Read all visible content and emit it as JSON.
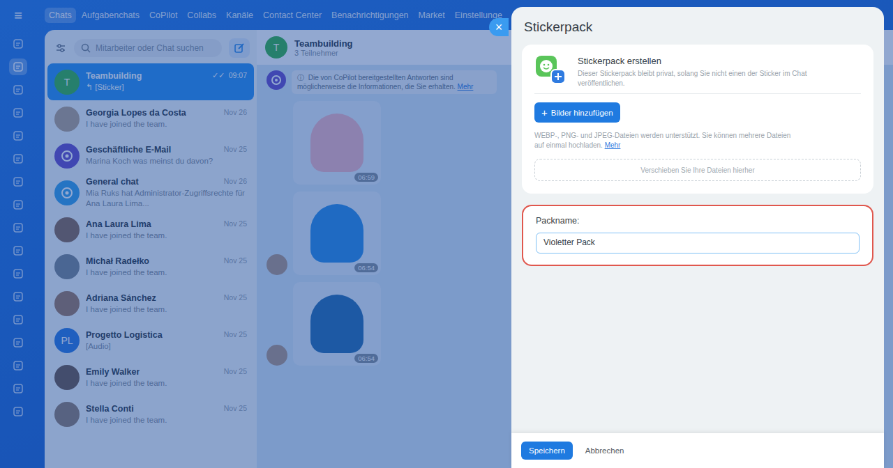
{
  "menu_icon": "≡",
  "nav": {
    "tabs": [
      {
        "label": "Chats",
        "selected": true
      },
      {
        "label": "Aufgabenchats",
        "selected": false
      },
      {
        "label": "CoPilot",
        "selected": false
      },
      {
        "label": "Collabs",
        "selected": false
      },
      {
        "label": "Kanäle",
        "selected": false
      },
      {
        "label": "Contact Center",
        "selected": false
      },
      {
        "label": "Benachrichtigungen",
        "selected": false
      },
      {
        "label": "Market",
        "selected": false
      },
      {
        "label": "Einstellunge",
        "selected": false
      }
    ]
  },
  "rail": {
    "items": [
      {
        "selected": false
      },
      {
        "selected": true
      },
      {
        "selected": false
      },
      {
        "selected": false
      },
      {
        "selected": false
      },
      {
        "selected": false
      },
      {
        "selected": false
      },
      {
        "selected": false
      },
      {
        "selected": false
      },
      {
        "selected": false
      },
      {
        "selected": false
      },
      {
        "selected": false
      },
      {
        "selected": false
      },
      {
        "selected": false
      },
      {
        "selected": false
      },
      {
        "selected": false
      },
      {
        "selected": false
      }
    ]
  },
  "chat_list": {
    "search_placeholder": "Mitarbeiter oder Chat suchen",
    "items": [
      {
        "name": "Teambuilding",
        "preview": "↰ [Sticker]",
        "time": "09:07",
        "read_mark": "✓✓",
        "kind": "initials",
        "avatar": "T",
        "color": "#3bb54a",
        "selected": true
      },
      {
        "name": "Georgia Lopes da Costa",
        "preview": "I have joined the team.",
        "time": "Nov 26",
        "read_mark": "",
        "kind": "photo",
        "avatar": "",
        "color": "#b9a48e",
        "selected": false
      },
      {
        "name": "Geschäftliche E-Mail",
        "preview": "Marina Koch was meinst du davon?",
        "time": "Nov 25",
        "read_mark": "",
        "kind": "icon",
        "avatar": "",
        "color": "#6a4fc9",
        "selected": false
      },
      {
        "name": "General chat",
        "preview": "Mia Ruks hat Administrator-Zugriffsrechte für Ana Laura Lima...",
        "time": "Nov 26",
        "read_mark": "",
        "kind": "icon",
        "avatar": "",
        "color": "#3aa0e8",
        "selected": false
      },
      {
        "name": "Ana Laura Lima",
        "preview": "I have joined the team.",
        "time": "Nov 25",
        "read_mark": "",
        "kind": "photo",
        "avatar": "",
        "color": "#8a6a55",
        "selected": false
      },
      {
        "name": "Michał Radełko",
        "preview": "I have joined the team.",
        "time": "Nov 25",
        "read_mark": "",
        "kind": "photo",
        "avatar": "",
        "color": "#7d8790",
        "selected": false
      },
      {
        "name": "Adriana Sánchez",
        "preview": "I have joined the team.",
        "time": "Nov 25",
        "read_mark": "",
        "kind": "photo",
        "avatar": "",
        "color": "#a07a62",
        "selected": false
      },
      {
        "name": "Progetto Logistica",
        "preview": "[Audio]",
        "time": "Nov 25",
        "read_mark": "",
        "kind": "initials",
        "avatar": "PL",
        "color": "#2f7be0",
        "selected": false
      },
      {
        "name": "Emily Walker",
        "preview": "I have joined the team.",
        "time": "Nov 25",
        "read_mark": "",
        "kind": "photo",
        "avatar": "",
        "color": "#6f5a4c",
        "selected": false
      },
      {
        "name": "Stella Conti",
        "preview": "I have joined the team.",
        "time": "Nov 25",
        "read_mark": "",
        "kind": "photo",
        "avatar": "",
        "color": "#94806f",
        "selected": false
      }
    ]
  },
  "chat": {
    "avatar": "T",
    "title": "Teambuilding",
    "subtitle": "3 Teilnehmer",
    "notice_icon": "ⓘ",
    "notice": "Die von CoPilot bereitgestellten Antworten sind möglicherweise die Informationen, die Sie erhalten.",
    "notice_link": "Mehr",
    "messages": [
      {
        "time": "06:59",
        "show_avatar": false,
        "color": "#f4b8c4"
      },
      {
        "time": "06:54",
        "show_avatar": true,
        "color": "#2f8fe6"
      },
      {
        "time": "06:54",
        "show_avatar": true,
        "color": "#2b6fb0"
      }
    ]
  },
  "panel": {
    "close": "×",
    "title": "Stickerpack",
    "create_title": "Stickerpack erstellen",
    "create_desc": "Dieser Stickerpack bleibt privat, solang Sie nicht einen der Sticker im Chat veröffentlichen.",
    "add_icon": "+",
    "add_label": "Bilder hinzufügen",
    "hint": "WEBP-, PNG- und JPEG-Dateien werden unterstützt. Sie können mehrere Dateien auf einmal hochladen.",
    "hint_link": "Mehr",
    "dropzone": "Verschieben Sie Ihre Dateien hierher",
    "name_label": "Packname:",
    "name_value": "Violetter Pack",
    "name_highlighted": true,
    "save": "Speichern",
    "cancel": "Abbrechen"
  }
}
